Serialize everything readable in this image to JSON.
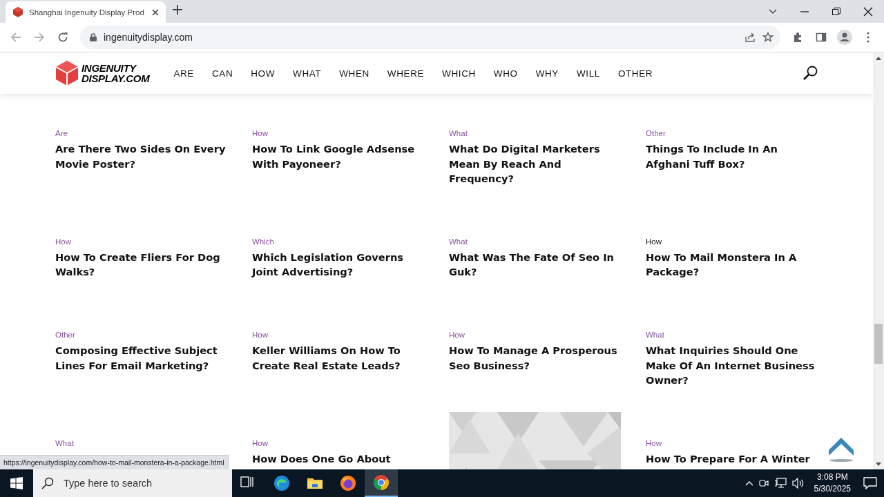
{
  "browser": {
    "tabs": [
      {
        "title": "Shanghai Ingenuity Display Prod",
        "selected": true
      }
    ],
    "nav": {
      "back_disabled": true,
      "forward_disabled": true
    },
    "address": "ingenuitydisplay.com"
  },
  "site": {
    "logo": [
      "INGENUITY",
      "DISPLAY.COM"
    ],
    "menu": [
      "ARE",
      "CAN",
      "HOW",
      "WHAT",
      "WHEN",
      "WHERE",
      "WHICH",
      "WHO",
      "WHY",
      "WILL",
      "OTHER"
    ]
  },
  "posts": [
    {
      "kind": "article",
      "category": "Are",
      "title": "Are There Two Sides On Every Movie Poster?",
      "hovered": false
    },
    {
      "kind": "article",
      "category": "How",
      "title": "How To Link Google Adsense With Payoneer?",
      "hovered": false
    },
    {
      "kind": "article",
      "category": "What",
      "title": "What Do Digital Marketers Mean By Reach And Frequency?",
      "hovered": false
    },
    {
      "kind": "article",
      "category": "Other",
      "title": "Things To Include In An Afghani Tuff Box?",
      "hovered": false
    },
    {
      "kind": "article",
      "category": "How",
      "title": "How To Create Fliers For Dog Walks?",
      "hovered": false
    },
    {
      "kind": "article",
      "category": "Which",
      "title": "Which Legislation Governs Joint Advertising?",
      "hovered": false
    },
    {
      "kind": "article",
      "category": "What",
      "title": "What Was The Fate Of Seo In Guk?",
      "hovered": false
    },
    {
      "kind": "article",
      "category": "How",
      "title": "How To Mail Monstera In A Package?",
      "hovered": true
    },
    {
      "kind": "article",
      "category": "Other",
      "title": "Composing Effective Subject Lines For Email Marketing?",
      "hovered": false
    },
    {
      "kind": "article",
      "category": "How",
      "title": "Keller Williams On How To Create Real Estate Leads?",
      "hovered": false
    },
    {
      "kind": "article",
      "category": "How",
      "title": "How To Manage A Prosperous Seo Business?",
      "hovered": false
    },
    {
      "kind": "article",
      "category": "What",
      "title": "What Inquiries Should One Make Of An Internet Business Owner?",
      "hovered": false
    },
    {
      "kind": "article",
      "category": "What",
      "hovered": false
    },
    {
      "kind": "article",
      "category": "How",
      "title": "How Does One Go About",
      "hovered": false
    },
    {
      "kind": "picture"
    },
    {
      "kind": "article",
      "category": "How",
      "title": "How To Prepare For A Winter",
      "hovered": false
    }
  ],
  "status_url": "https://ingenuitydisplay.com/how-to-mail-monstera-in-a-package.html",
  "taskbar": {
    "search": {
      "placeholder": "Type here to search"
    },
    "apps": [
      {
        "kind": "taskview",
        "active": false
      },
      {
        "kind": "edge",
        "active": false
      },
      {
        "kind": "explorer",
        "active": false
      },
      {
        "kind": "firefox",
        "active": false
      },
      {
        "kind": "chrome",
        "active": true
      }
    ],
    "time": "3:08 PM",
    "date": "5/30/2025"
  }
}
